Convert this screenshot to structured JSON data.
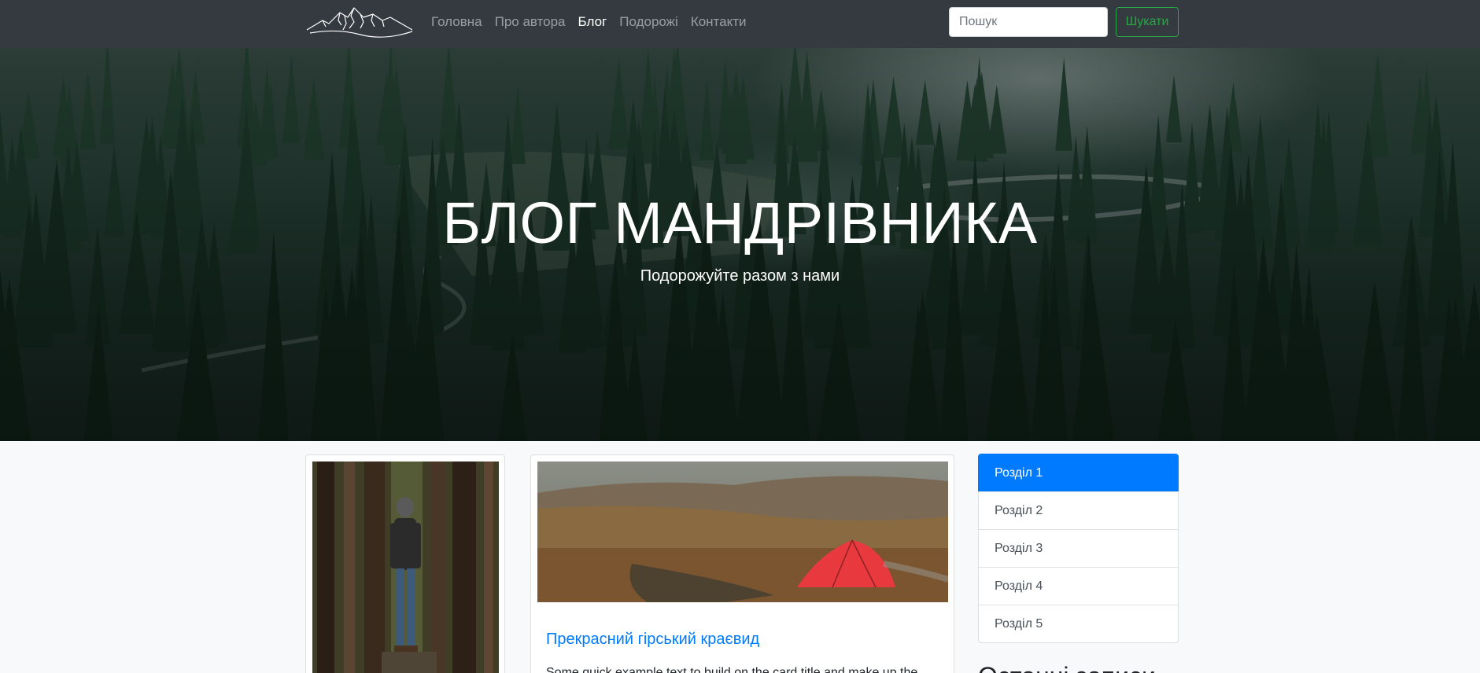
{
  "navbar": {
    "brand_icon": "mountains-logo-icon",
    "links": [
      {
        "label": "Головна",
        "active": false
      },
      {
        "label": "Про автора",
        "active": false
      },
      {
        "label": "Блог",
        "active": true
      },
      {
        "label": "Подорожі",
        "active": false
      },
      {
        "label": "Контакти",
        "active": false
      }
    ],
    "search": {
      "placeholder": "Пошук",
      "button_label": "Шукати"
    }
  },
  "hero": {
    "title": "БЛОГ МАНДРІВНИКА",
    "subtitle": "Подорожуйте разом з нами"
  },
  "main": {
    "cards": [
      {
        "image": "hiker-in-forest-photo"
      },
      {
        "image": "red-tent-mountain-photo",
        "title": "Прекрасний гірський краєвид",
        "text": "Some quick example text to build on the card title and make up the"
      }
    ]
  },
  "sidebar": {
    "items": [
      {
        "label": "Розділ 1",
        "active": true
      },
      {
        "label": "Розділ 2",
        "active": false
      },
      {
        "label": "Розділ 3",
        "active": false
      },
      {
        "label": "Розділ 4",
        "active": false
      },
      {
        "label": "Розділ 5",
        "active": false
      }
    ],
    "heading": "Останні записи"
  },
  "colors": {
    "navbar_bg": "#343a40",
    "accent": "#007bff",
    "success": "#28a745"
  }
}
